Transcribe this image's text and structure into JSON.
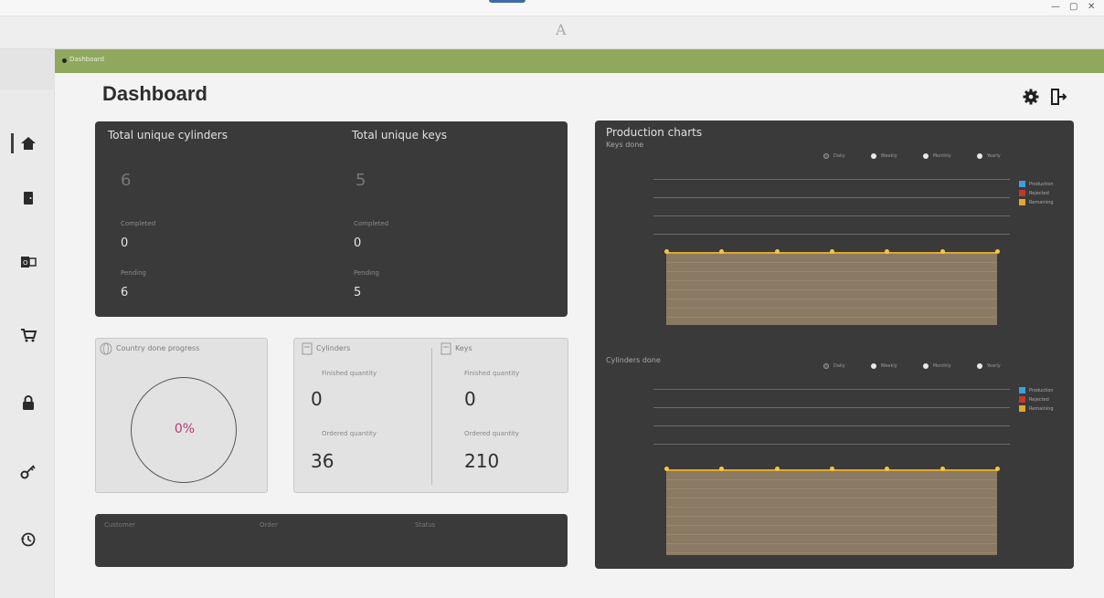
{
  "window": {
    "title": "",
    "minimize": "—",
    "maximize": "▢",
    "close": "✕"
  },
  "app": {
    "logo_char": "A"
  },
  "breadcrumb": {
    "text": "Dashboard"
  },
  "header": {
    "title": "Dashboard"
  },
  "totals": {
    "cylinders": {
      "title": "Total unique cylinders",
      "value": "6",
      "label_a": "Completed",
      "value_a": "0",
      "label_b": "Pending",
      "value_b": "6"
    },
    "keys": {
      "title": "Total unique keys",
      "value": "5",
      "label_a": "Completed",
      "value_a": "0",
      "label_b": "Pending",
      "value_b": "5"
    }
  },
  "progress": {
    "title": "Country done progress",
    "percent": "0%"
  },
  "quantities": {
    "cylinders": {
      "title": "Cylinders",
      "label_a": "Finished quantity",
      "value_a": "0",
      "label_b": "Ordered quantity",
      "value_b": "36"
    },
    "keys": {
      "title": "Keys",
      "label_a": "Finished quantity",
      "value_a": "0",
      "label_b": "Ordered quantity",
      "value_b": "210"
    }
  },
  "table": {
    "columns": [
      "Customer",
      "Order",
      "Status"
    ]
  },
  "charts": {
    "title": "Production charts",
    "filters": [
      "Daily",
      "Weekly",
      "Monthly",
      "Yearly"
    ],
    "legend": [
      {
        "name": "Production",
        "color": "#3aa0e0"
      },
      {
        "name": "Rejected",
        "color": "#c0392b"
      },
      {
        "name": "Remaining",
        "color": "#e0a82c"
      }
    ],
    "keys_chart": {
      "subtitle": "Keys done"
    },
    "cylinders_chart": {
      "subtitle": "Cylinders done"
    }
  },
  "chart_data": [
    {
      "type": "area",
      "title": "Keys done",
      "x": [
        "",
        "",
        "",
        "",
        "",
        "",
        ""
      ],
      "series": [
        {
          "name": "Remaining",
          "values": [
            0,
            0,
            0,
            0,
            0,
            0,
            0
          ]
        }
      ]
    },
    {
      "type": "area",
      "title": "Cylinders done",
      "x": [
        "",
        "",
        "",
        "",
        "",
        "",
        ""
      ],
      "series": [
        {
          "name": "Remaining",
          "values": [
            0,
            0,
            0,
            0,
            0,
            0,
            0
          ]
        }
      ]
    }
  ],
  "icons": {
    "sidebar": [
      "home-icon",
      "door-icon",
      "outlook-icon",
      "cart-icon",
      "lock-icon",
      "key-icon",
      "history-icon"
    ],
    "header": [
      "gear-icon",
      "logout-icon"
    ]
  }
}
